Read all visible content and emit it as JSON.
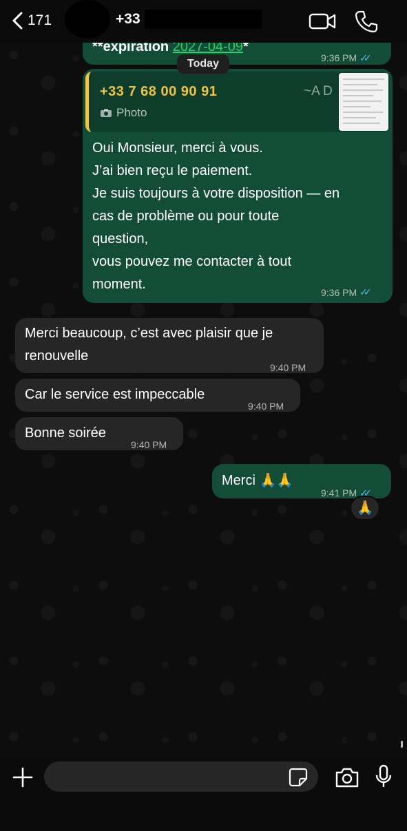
{
  "header": {
    "back_count": "171",
    "contact_name": "+33"
  },
  "date_separator": "Today",
  "messages": [
    {
      "direction": "out",
      "prefix": "**expiration ",
      "highlight": "2027-04-09",
      "suffix": "*",
      "time": "9:36 PM",
      "ticks": "✓✓"
    },
    {
      "direction": "out",
      "quote": {
        "sender": "+33 7 68 00 90 91",
        "author": "~A D",
        "type": "Photo"
      },
      "lines": [
        "Oui Monsieur, merci à vous.",
        "J’ai bien reçu le paiement.",
        "Je suis toujours à votre disposition — en",
        "cas de problème ou pour toute",
        "question,",
        "vous pouvez me contacter à tout",
        "moment."
      ],
      "time": "9:36 PM",
      "ticks": "✓✓"
    },
    {
      "direction": "in",
      "lines": [
        "Merci beaucoup, c’est avec plaisir que je",
        "renouvelle"
      ],
      "time": "9:40 PM"
    },
    {
      "direction": "in",
      "text": "Car le service est impeccable",
      "time": "9:40 PM"
    },
    {
      "direction": "in",
      "text": "Bonne soirée",
      "time": "9:40 PM"
    },
    {
      "direction": "out",
      "text": "Merci 🙏🙏",
      "time": "9:41 PM",
      "ticks": "✓✓",
      "reaction": "🙏"
    }
  ],
  "composer": {
    "value": "",
    "placeholder": ""
  },
  "colors": {
    "outgoing_bubble": "#144d37",
    "incoming_bubble": "#262626",
    "read_ticks": "#53bdeb",
    "quote_accent": "#f1c442",
    "date_highlight": "#25d366"
  },
  "icons": [
    "chevron-left-icon",
    "video-call-icon",
    "phone-icon",
    "plus-icon",
    "sticker-icon",
    "camera-icon",
    "microphone-icon",
    "camera-small-icon",
    "double-check-icon"
  ]
}
